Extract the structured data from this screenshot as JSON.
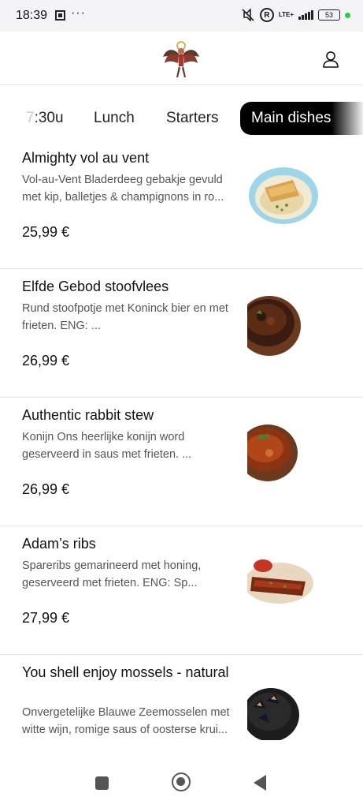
{
  "status_bar": {
    "time": "18:39",
    "dots": "···",
    "network": "LTE+",
    "battery": "53",
    "r_badge": "R"
  },
  "header": {
    "logo_icon": "angel-logo-icon",
    "account_icon": "user-icon"
  },
  "tabs": [
    {
      "label_faded": "7",
      "label": ":30u"
    },
    {
      "label": "Lunch"
    },
    {
      "label": "Starters"
    },
    {
      "label": "Main dishes",
      "active": true
    }
  ],
  "menu": [
    {
      "title": "Almighty vol au vent",
      "description": "Vol-au-Vent Bladerdeeg gebakje gevuld met kip, balletjes & champignons in ro...",
      "price": "25,99 €"
    },
    {
      "title": "Elfde Gebod stoofvlees",
      "description": "Rund stoofpotje met Koninck bier en met frieten. ENG: ...",
      "price": "26,99 €"
    },
    {
      "title": "Authentic rabbit stew",
      "description": "Konijn Ons heerlijke konijn word geserveerd in saus met frieten. ...",
      "price": "26,99 €"
    },
    {
      "title": "Adam’s ribs",
      "description": "Spareribs gemarineerd met honing, geserveerd met frieten. ENG: Sp...",
      "price": "27,99 €"
    },
    {
      "title": "You shell enjoy mossels - natural",
      "description": "Onvergetelijke Blauwe Zeemosselen met witte wijn, romige saus of oosterse krui...",
      "price": ""
    }
  ],
  "colors": {
    "active_tab_bg": "#000000",
    "divider": "#e3e3e3",
    "description_text": "#555555"
  }
}
